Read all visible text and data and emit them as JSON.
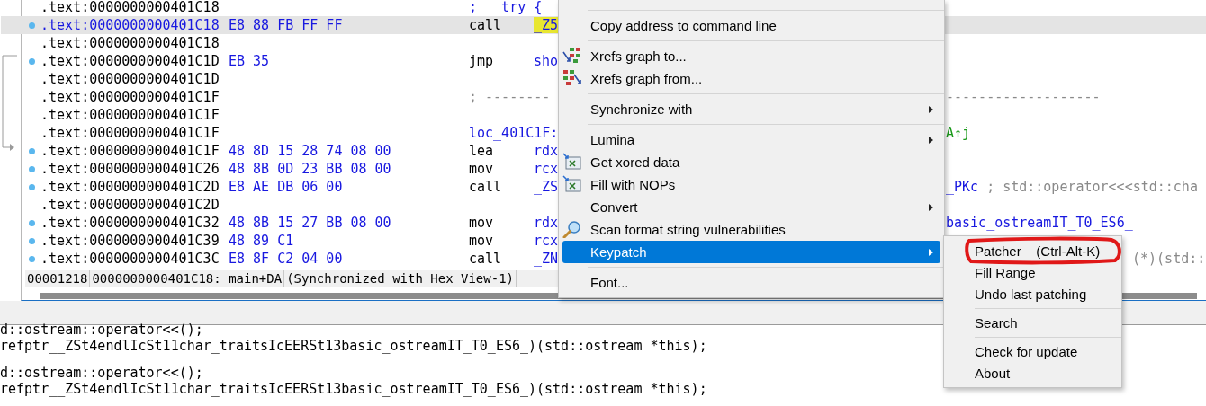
{
  "listing": {
    "rows": [
      {
        "address": ".text:0000000000401C18",
        "selected": false,
        "marker": false,
        "kind": "comment",
        "text": ";   try {"
      },
      {
        "address": ".text:0000000000401C18",
        "selected": true,
        "marker": true,
        "kind": "insn",
        "bytes": "E8 88 FB FF FF",
        "mnemonic": "call",
        "operand": "_Z5",
        "highlighted": true
      },
      {
        "address": ".text:0000000000401C18",
        "selected": false,
        "marker": false,
        "kind": "blank"
      },
      {
        "address": ".text:0000000000401C1D",
        "selected": false,
        "marker": true,
        "kind": "insn",
        "bytes": "EB 35",
        "mnemonic": "jmp",
        "operand": "sho",
        "highlighted": false
      },
      {
        "address": ".text:0000000000401C1D",
        "selected": false,
        "marker": false,
        "kind": "blank"
      },
      {
        "address": ".text:0000000000401C1F",
        "selected": false,
        "marker": false,
        "kind": "separator",
        "text": "; --------",
        "right": [
          {
            "text": "-------------------",
            "kind": "comment"
          }
        ]
      },
      {
        "address": ".text:0000000000401C1F",
        "selected": false,
        "marker": false,
        "kind": "blank"
      },
      {
        "address": ".text:0000000000401C1F",
        "selected": false,
        "marker": false,
        "kind": "label",
        "text": "loc_401C1F:",
        "right": [
          {
            "text": "A↑j",
            "kind": "xref"
          }
        ]
      },
      {
        "address": ".text:0000000000401C1F",
        "selected": false,
        "marker": true,
        "kind": "insn",
        "bytes": "48 8D 15 28 74 08 00",
        "mnemonic": "lea",
        "operand": "rdx",
        "highlighted": false
      },
      {
        "address": ".text:0000000000401C26",
        "selected": false,
        "marker": true,
        "kind": "insn",
        "bytes": "48 8B 0D 23 BB 08 00",
        "mnemonic": "mov",
        "operand": "rcx",
        "highlighted": false
      },
      {
        "address": ".text:0000000000401C2D",
        "selected": false,
        "marker": true,
        "kind": "insn",
        "bytes": "E8 AE DB 06 00",
        "mnemonic": "call",
        "operand": "_ZS",
        "highlighted": false,
        "right": [
          {
            "text": "_PKc",
            "kind": "name"
          },
          {
            "text": "; std::operator<<<std::cha",
            "kind": "comment"
          }
        ]
      },
      {
        "address": ".text:0000000000401C2D",
        "selected": false,
        "marker": false,
        "kind": "blank"
      },
      {
        "address": ".text:0000000000401C32",
        "selected": false,
        "marker": true,
        "kind": "insn",
        "bytes": "48 8B 15 27 BB 08 00",
        "mnemonic": "mov",
        "operand": "rdx",
        "highlighted": false,
        "right": [
          {
            "text": "basic_ostreamIT_T0_ES6_",
            "kind": "name"
          }
        ]
      },
      {
        "address": ".text:0000000000401C39",
        "selected": false,
        "marker": true,
        "kind": "insn",
        "bytes": "48 89 C1",
        "mnemonic": "mov",
        "operand": "rcx",
        "highlighted": false
      },
      {
        "address": ".text:0000000000401C3C",
        "selected": false,
        "marker": true,
        "kind": "insn",
        "bytes": "E8 8F C2 04 00",
        "mnemonic": "call",
        "operand": "_ZN",
        "highlighted": false,
        "right": [
          {
            "text": "(*)(std::",
            "kind": "comment"
          }
        ]
      }
    ],
    "status_bar": [
      "00001218",
      "0000000000401C18: main+DA",
      "(Synchronized with Hex View-1)"
    ]
  },
  "pseudocode_blocks": [
    [
      "d::ostream::operator<<();",
      "refptr__ZSt4endlIcSt11char_traitsIcEERSt13basic_ostreamIT_T0_ES6_)(std::ostream *this);"
    ],
    [
      "d::ostream::operator<<();",
      "refptr__ZSt4endlIcSt11char_traitsIcEERSt13basic_ostreamIT_T0_ES6_)(std::ostream *this);"
    ]
  ],
  "context_menu": {
    "items": [
      {
        "kind": "separator"
      },
      {
        "kind": "item",
        "label": "Copy address to command line",
        "selected": false
      },
      {
        "kind": "separator"
      },
      {
        "kind": "item",
        "label": "Xrefs graph to...",
        "selected": false
      },
      {
        "kind": "item",
        "label": "Xrefs graph from...",
        "selected": false
      },
      {
        "kind": "separator"
      },
      {
        "kind": "submenu",
        "label": "Synchronize with",
        "selected": false
      },
      {
        "kind": "separator"
      },
      {
        "kind": "submenu",
        "label": "Lumina",
        "selected": false
      },
      {
        "kind": "item",
        "label": "Get xored data",
        "selected": false
      },
      {
        "kind": "item",
        "label": "Fill with NOPs",
        "selected": false
      },
      {
        "kind": "submenu",
        "label": "Convert",
        "selected": false
      },
      {
        "kind": "item",
        "label": "Scan format string vulnerabilities",
        "selected": false
      },
      {
        "kind": "submenu",
        "label": "Keypatch",
        "selected": true
      },
      {
        "kind": "separator"
      },
      {
        "kind": "item",
        "label": "Font...",
        "selected": false
      }
    ]
  },
  "submenu": {
    "items": [
      {
        "kind": "item",
        "label": "Patcher    (Ctrl-Alt-K)",
        "circled": true
      },
      {
        "kind": "item",
        "label": "Fill Range",
        "circled": false
      },
      {
        "kind": "item",
        "label": "Undo last patching",
        "circled": false
      },
      {
        "kind": "separator"
      },
      {
        "kind": "item",
        "label": "Search",
        "circled": false
      },
      {
        "kind": "separator"
      },
      {
        "kind": "item",
        "label": "Check for update",
        "circled": false
      },
      {
        "kind": "item",
        "label": "About",
        "circled": false
      }
    ]
  }
}
